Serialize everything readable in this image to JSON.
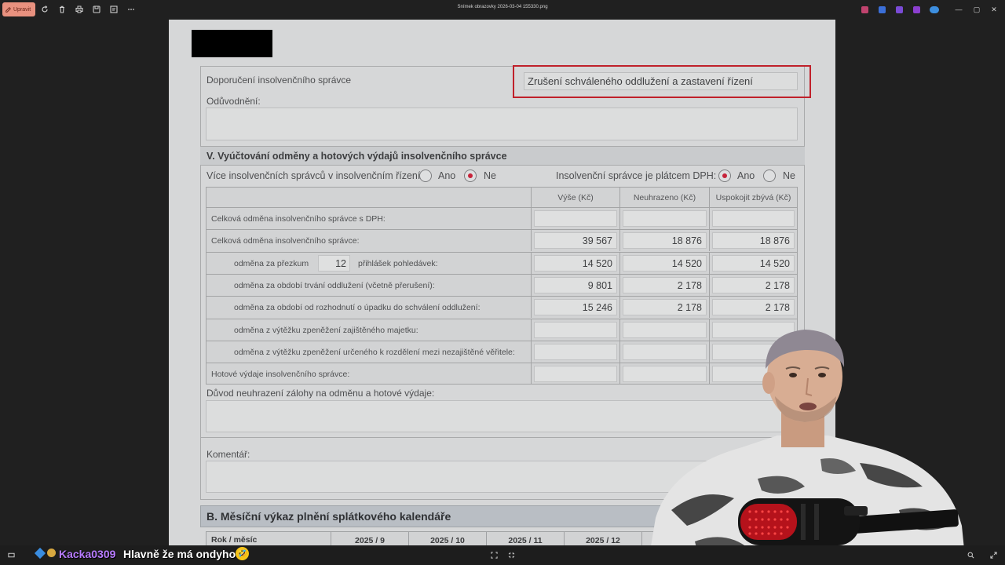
{
  "toolbar": {
    "edit_label": "Upravit",
    "file_title": "Snímek obrazovky 2026-03-04 155330.png",
    "minimize": "—",
    "maximize": "▢",
    "close": "✕"
  },
  "form": {
    "recommend_label": "Doporučení insolvenčního správce",
    "recommend_value": "Zrušení schváleného oddlužení a zastavení řízení",
    "reason_label": "Odůvodnění:",
    "section_v_title": "V. Vyúčtování odměny a hotových výdajů insolvenčního správce",
    "multi_admin_label": "Více insolvenčních správců v insolvenčním řízení:",
    "vat_label": "Insolvenční správce je plátcem DPH:",
    "yes": "Ano",
    "no": "Ne",
    "unpaid_reason_label": "Důvod neuhrazení zálohy na odměnu a hotové výdaje:",
    "comment_label": "Komentář:",
    "section_b_title": "B. Měsíční výkaz plnění splátkového kalendáře"
  },
  "table": {
    "headers": [
      "Výše (Kč)",
      "Neuhrazeno (Kč)",
      "Uspokojit zbývá (Kč)"
    ],
    "rows": [
      {
        "label": "Celková odměna insolvenčního správce s DPH:",
        "indent": false,
        "values": [
          "",
          "",
          ""
        ]
      },
      {
        "label": "Celková odměna insolvenčního správce:",
        "indent": false,
        "values": [
          "39 567",
          "18 876",
          "18 876"
        ]
      },
      {
        "label": "odměna za přezkum",
        "label_after": "přihlášek pohledávek:",
        "count": "12",
        "indent": true,
        "values": [
          "14 520",
          "14 520",
          "14 520"
        ]
      },
      {
        "label": "odměna za období trvání oddlužení (včetně přerušení):",
        "indent": true,
        "values": [
          "9 801",
          "2 178",
          "2 178"
        ]
      },
      {
        "label": "odměna za období od rozhodnutí o úpadku do schválení oddlužení:",
        "indent": true,
        "values": [
          "15 246",
          "2 178",
          "2 178"
        ]
      },
      {
        "label": "odměna z výtěžku zpeněžení zajištěného majetku:",
        "indent": true,
        "values": [
          "",
          "",
          ""
        ]
      },
      {
        "label": "odměna z výtěžku zpeněžení určeného k rozdělení mezi nezajištěné věřitele:",
        "indent": true,
        "values": [
          "",
          "",
          ""
        ]
      },
      {
        "label": "Hotové výdaje insolvenčního správce:",
        "indent": false,
        "values": [
          "",
          "",
          ""
        ]
      }
    ]
  },
  "table_b": {
    "first_header": "Rok / měsíc",
    "months": [
      "2025 / 9",
      "2025 / 10",
      "2025 / 11",
      "2025 / 12"
    ]
  },
  "chat": {
    "username": "Kacka0309",
    "message": "Hlavně že má ondyho",
    "emoji": "🤣"
  },
  "colors": {
    "highlight": "#c0202a",
    "radio_selected": "#c7233a",
    "chat_username": "#b77bff"
  }
}
